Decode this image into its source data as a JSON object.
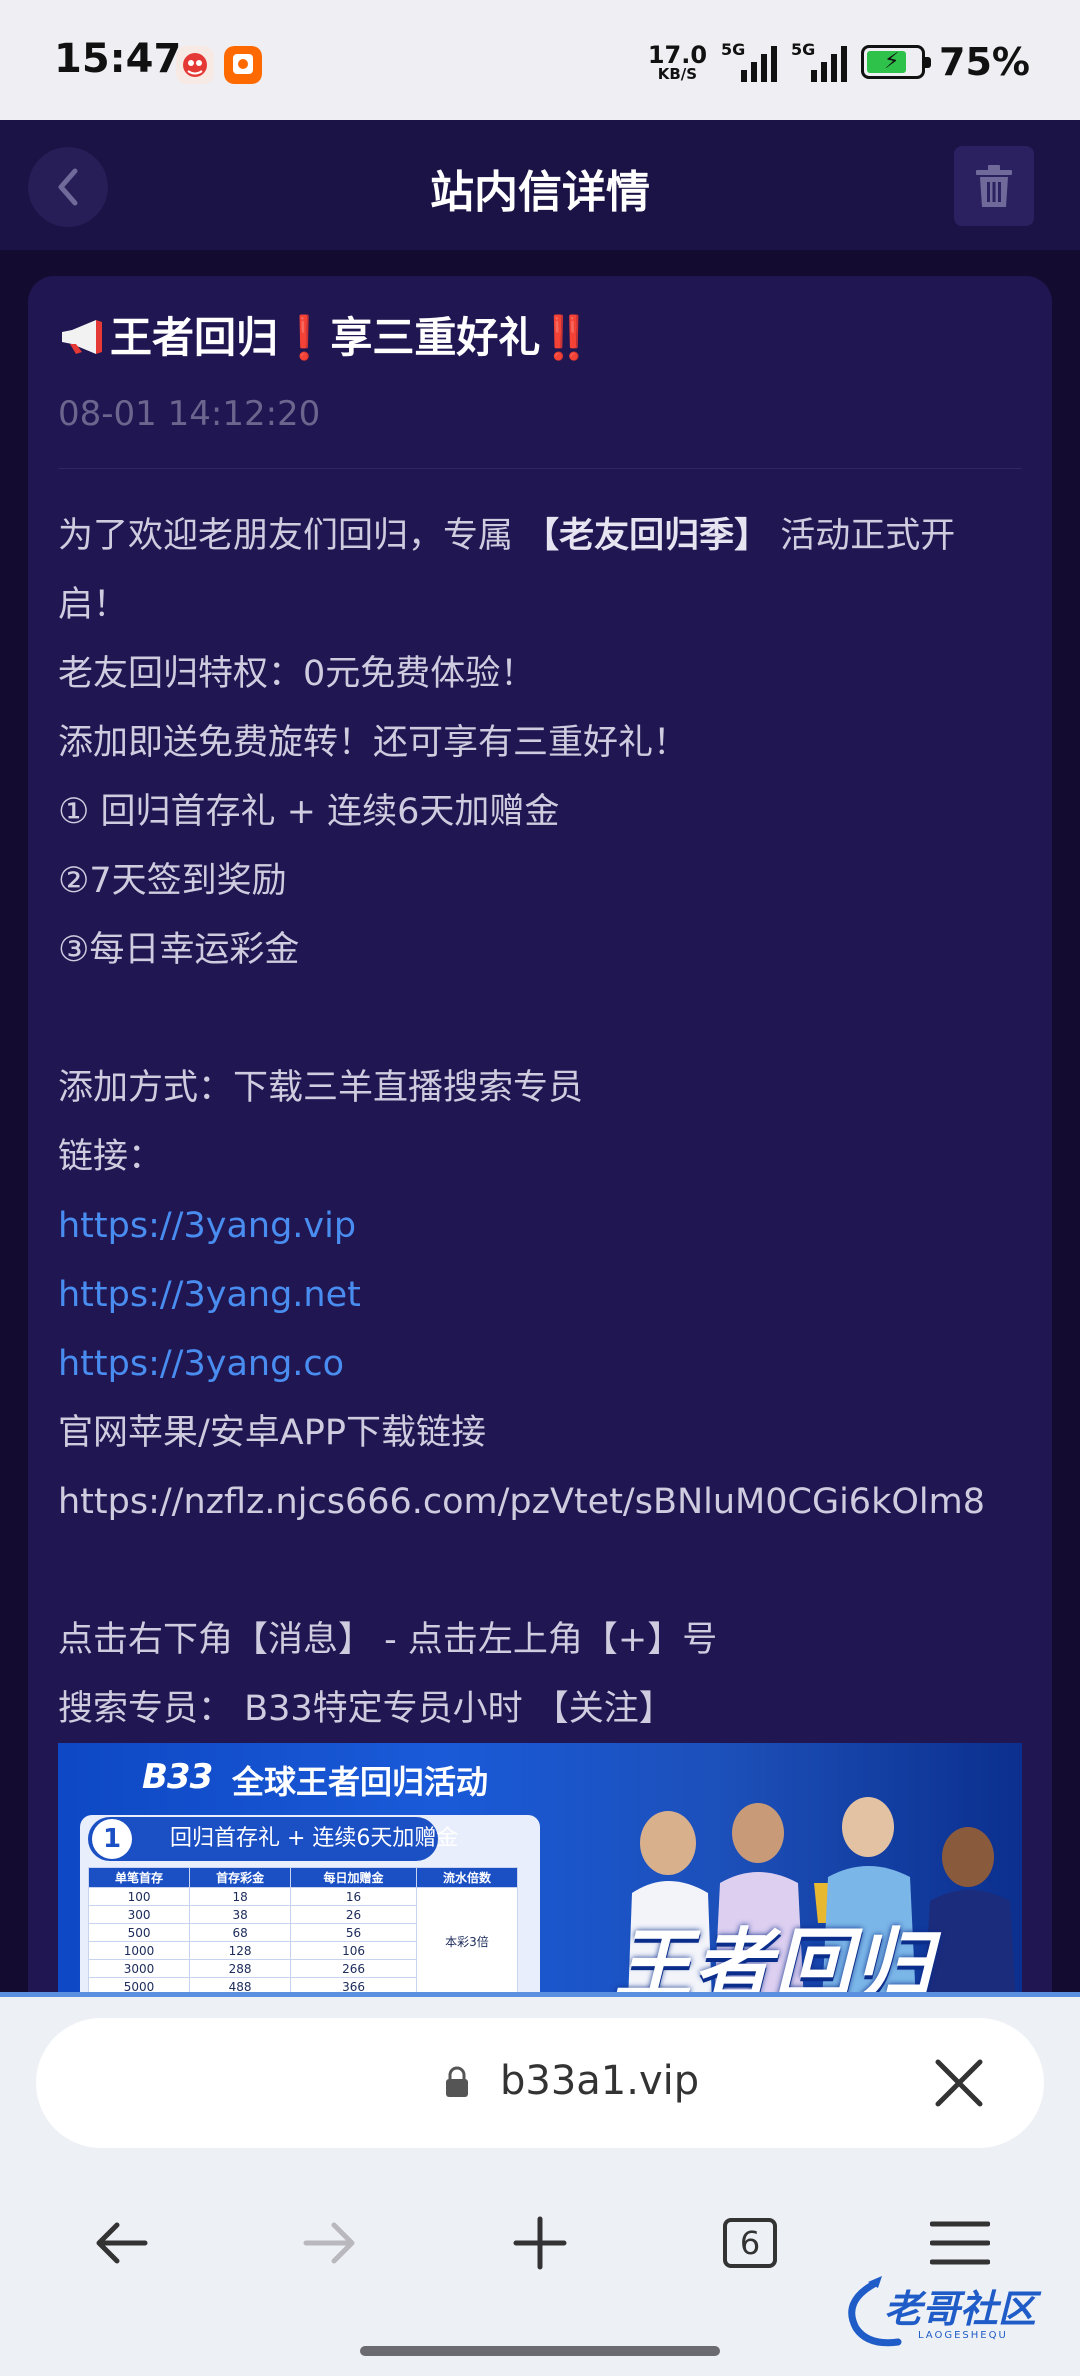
{
  "status_bar": {
    "time": "15:47",
    "net_speed": "17.0",
    "net_speed_unit": "KB/S",
    "sim1_label": "5G",
    "sim2_label": "5G",
    "battery_percent": "75%",
    "battery_level": 0.75
  },
  "header": {
    "title": "站内信详情"
  },
  "message": {
    "title_text": "王者回归",
    "title_mid": "享三重好礼",
    "title_ex1": "❗",
    "title_ex2": "‼️",
    "datetime": "08-01 14:12:20",
    "intro_pre": "为了欢迎老朋友们回归，专属",
    "intro_bold": "【老友回归季】",
    "intro_post": " 活动正式开",
    "intro_wrap": "启！",
    "line_privilege": "老友回归特权：0元免费体验！",
    "line_add": "添加即送免费旋转！还可享有三重好礼！",
    "gift_1": "① 回归首存礼 + 连续6天加赠金",
    "gift_2": "②7天签到奖励",
    "gift_3": "③每日幸运彩金",
    "add_method": "添加方式：下载三羊直播搜索专员",
    "links_label": "链接：",
    "link_1": "https://3yang.vip",
    "link_2": "https://3yang.net",
    "link_3": "https://3yang.co",
    "app_label": "官网苹果/安卓APP下载链接",
    "app_url": "https://nzflz.njcs666.com/pzVtet/sBNluM0CGi6kOlm8",
    "step_1": "点击右下角【消息】 - 点击左上角【+】号",
    "step_2": "搜索专员： B33特定专员小时 【关注】"
  },
  "banner": {
    "logo": "B33",
    "headline": "全球王者回归活动",
    "panel_num": "1",
    "panel_tag": "回归首存礼 + 连续6天加赠金",
    "table_headers": [
      "单笔首存",
      "首存彩金",
      "每日加赠金",
      "流水倍数"
    ],
    "table_rows": [
      [
        "100",
        "18",
        "16"
      ],
      [
        "300",
        "38",
        "26"
      ],
      [
        "500",
        "68",
        "56"
      ],
      [
        "1000",
        "128",
        "106"
      ],
      [
        "3000",
        "288",
        "266"
      ],
      [
        "5000",
        "488",
        "366"
      ]
    ],
    "multiplier": "本彩3倍",
    "big_text": "王者回归"
  },
  "browser": {
    "url": "b33a1.vip",
    "tab_count": "6"
  },
  "watermark": {
    "text": "老哥社区",
    "sub": "LAOGESHEQU"
  },
  "colors": {
    "page_bg": "#140c30",
    "header_bg": "#1b1245",
    "card_bg": "#1f1652",
    "link": "#4a8df0",
    "status_bar_bg": "#efeff3"
  }
}
